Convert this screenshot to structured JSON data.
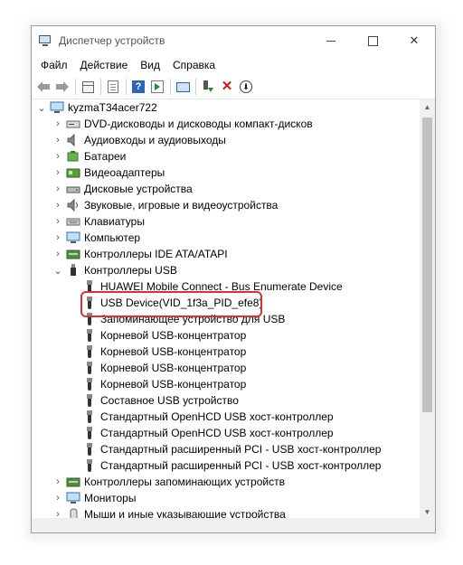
{
  "window": {
    "title": "Диспетчер устройств"
  },
  "menu": [
    "Файл",
    "Действие",
    "Вид",
    "Справка"
  ],
  "tree": {
    "root": "kyzmaT34acer722",
    "categories": [
      {
        "label": "DVD-дисководы и дисководы компакт-дисков",
        "icon": "dvd-drive-icon"
      },
      {
        "label": "Аудиовходы и аудиовыходы",
        "icon": "speaker-icon"
      },
      {
        "label": "Батареи",
        "icon": "battery-icon"
      },
      {
        "label": "Видеоадаптеры",
        "icon": "display-adapter-icon"
      },
      {
        "label": "Дисковые устройства",
        "icon": "disk-drive-icon"
      },
      {
        "label": "Звуковые, игровые и видеоустройства",
        "icon": "sound-icon"
      },
      {
        "label": "Клавиатуры",
        "icon": "keyboard-icon"
      },
      {
        "label": "Компьютер",
        "icon": "computer-icon"
      },
      {
        "label": "Контроллеры IDE ATA/ATAPI",
        "icon": "ide-controller-icon"
      },
      {
        "label": "Контроллеры USB",
        "icon": "usb-controller-icon"
      }
    ],
    "usb_children": [
      "HUAWEI Mobile Connect - Bus Enumerate Device",
      "USB Device(VID_1f3a_PID_efe8)",
      "Запоминающее устройство для USB",
      "Корневой USB-концентратор",
      "Корневой USB-концентратор",
      "Корневой USB-концентратор",
      "Корневой USB-концентратор",
      "Составное USB устройство",
      "Стандартный OpenHCD USB хост-контроллер",
      "Стандартный OpenHCD USB хост-контроллер",
      "Стандартный расширенный PCI - USB хост-контроллер",
      "Стандартный расширенный PCI - USB хост-контроллер"
    ],
    "after": [
      {
        "label": "Контроллеры запоминающих устройств",
        "icon": "storage-controller-icon"
      },
      {
        "label": "Мониторы",
        "icon": "monitor-icon"
      },
      {
        "label": "Мыши и иные указывающие устройства",
        "icon": "mouse-icon"
      }
    ]
  },
  "colors": {
    "highlight": "#e0302f",
    "selection_accent": "#2d63b5"
  }
}
